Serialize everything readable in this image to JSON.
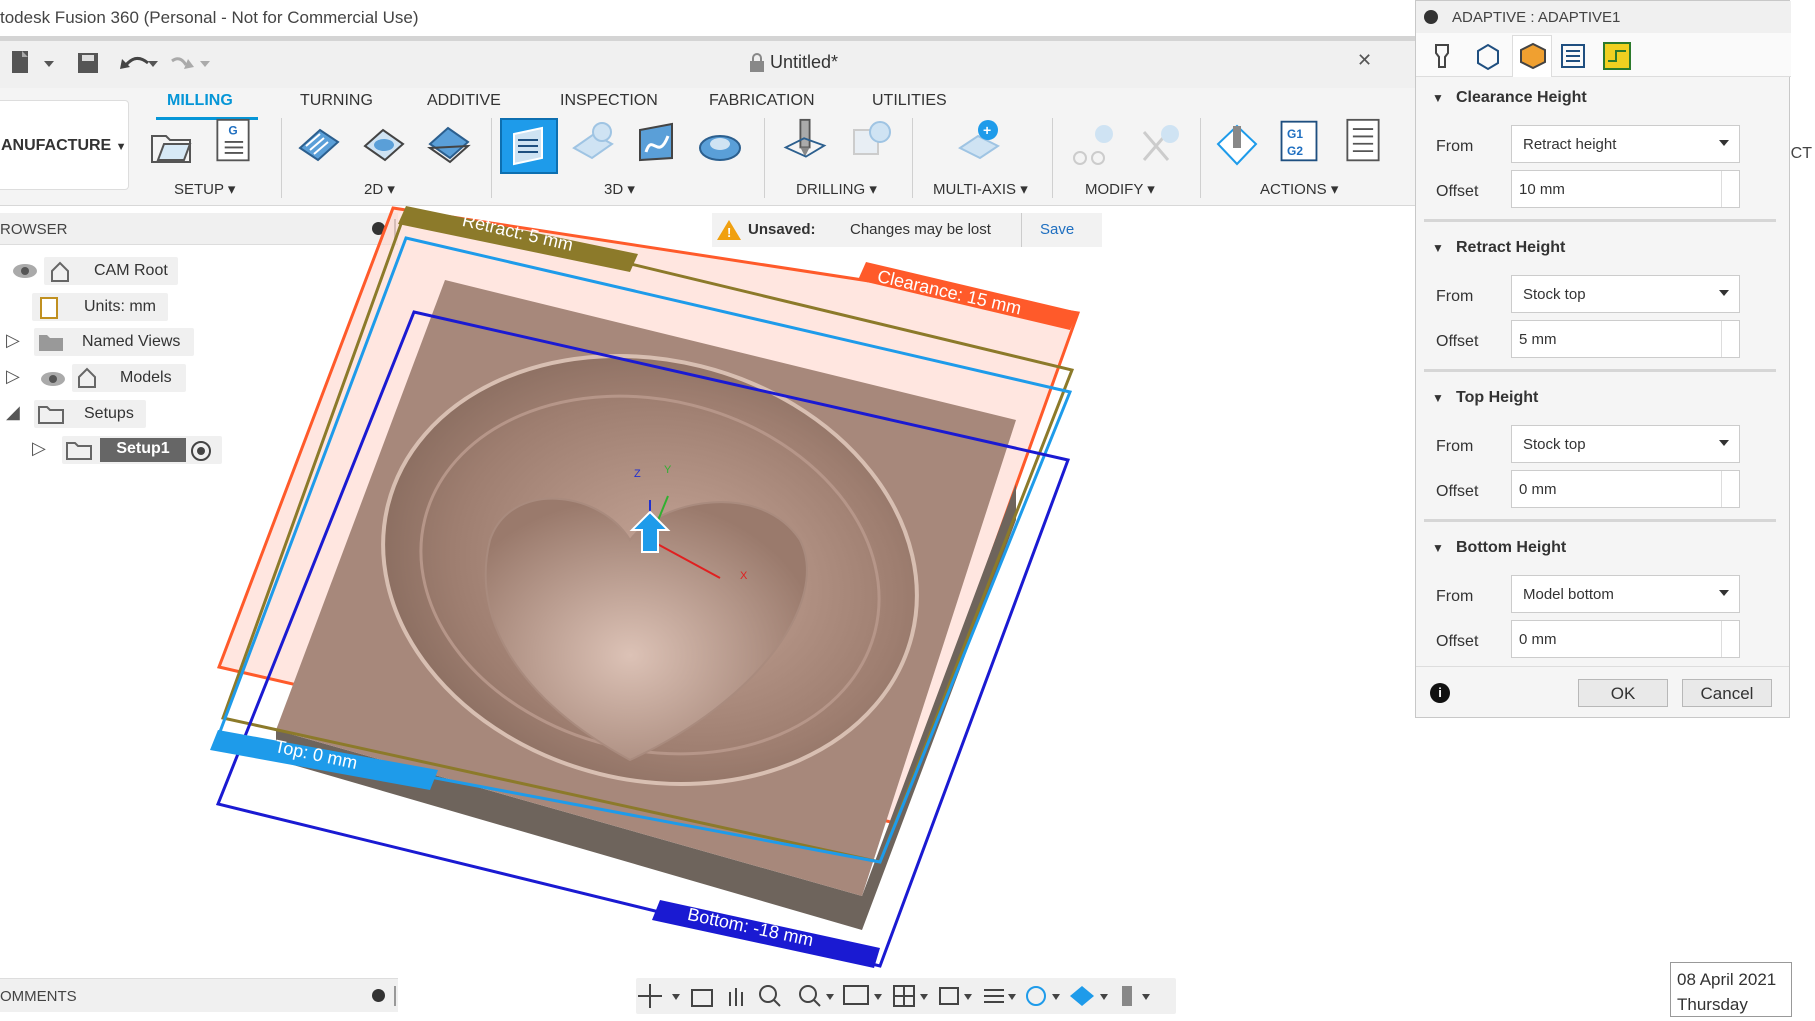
{
  "app": {
    "window_title": "todesk Fusion 360 (Personal - Not for Commercial Use)",
    "document_title": "Untitled*"
  },
  "ribbon": {
    "tabs": [
      "MILLING",
      "TURNING",
      "ADDITIVE",
      "INSPECTION",
      "FABRICATION",
      "UTILITIES"
    ],
    "active_tab": "MILLING",
    "workspace": "ANUFACTURE",
    "groups": [
      "SETUP",
      "2D",
      "3D",
      "DRILLING",
      "MULTI-AXIS",
      "MODIFY",
      "ACTIONS"
    ]
  },
  "browser": {
    "title": "ROWSER",
    "items": {
      "cam_root": "CAM Root",
      "units": "Units: mm",
      "named_views": "Named Views",
      "models": "Models",
      "setups": "Setups",
      "setup1": "Setup1"
    }
  },
  "unsaved": {
    "label": "Unsaved:",
    "message": "Changes may be lost",
    "save": "Save"
  },
  "viewport": {
    "labels": {
      "retract": "Retract: 5 mm",
      "clearance": "Clearance: 15 mm",
      "top": "Top: 0 mm",
      "bottom": "Bottom: -18 mm"
    },
    "axes": {
      "z": "Z",
      "y": "Y",
      "x": "X"
    },
    "colors": {
      "retract": "#8c7a2a",
      "clearance": "#ff5a2a",
      "top": "#1e9bea",
      "bottom": "#1a1ad2",
      "model": "#a8877a"
    }
  },
  "panel": {
    "title": "ADAPTIVE : ADAPTIVE1",
    "sections": {
      "clearance": {
        "title": "Clearance Height",
        "from_label": "From",
        "from_value": "Retract height",
        "offset_label": "Offset",
        "offset_value": "10 mm"
      },
      "retract": {
        "title": "Retract Height",
        "from_label": "From",
        "from_value": "Stock top",
        "offset_label": "Offset",
        "offset_value": "5 mm"
      },
      "top": {
        "title": "Top Height",
        "from_label": "From",
        "from_value": "Stock top",
        "offset_label": "Offset",
        "offset_value": "0 mm"
      },
      "bottom": {
        "title": "Bottom Height",
        "from_label": "From",
        "from_value": "Model bottom",
        "offset_label": "Offset",
        "offset_value": "0 mm"
      }
    },
    "ok": "OK",
    "cancel": "Cancel",
    "side_text": "ECT"
  },
  "comments": {
    "title": "OMMENTS"
  },
  "clock": {
    "date": "08 April 2021",
    "day": "Thursday"
  }
}
